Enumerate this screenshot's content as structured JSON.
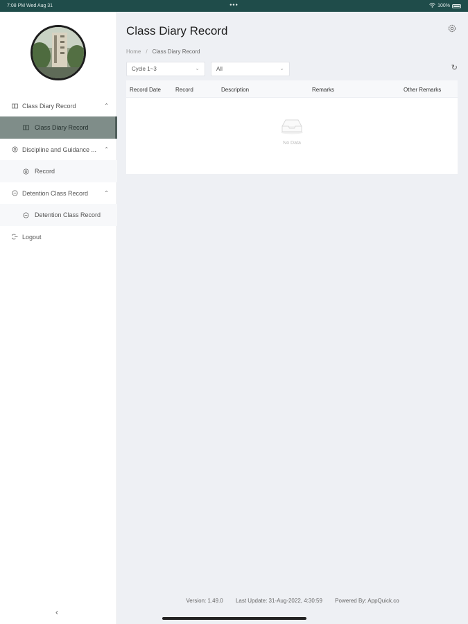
{
  "status_bar": {
    "time_date": "7:08 PM   Wed Aug 31",
    "center_dots": "•••",
    "battery_text": "100%"
  },
  "sidebar": {
    "menu": [
      {
        "label": "Class Diary Record",
        "icon": "book-icon",
        "children": [
          {
            "label": "Class Diary Record",
            "icon": "book-icon",
            "active": true
          }
        ]
      },
      {
        "label": "Discipline and Guidance ...",
        "icon": "settings-icon",
        "children": [
          {
            "label": "Record",
            "icon": "settings-icon",
            "active": false
          }
        ]
      },
      {
        "label": "Detention Class Record",
        "icon": "minus-circle-icon",
        "children": [
          {
            "label": "Detention Class Record",
            "icon": "minus-circle-icon",
            "active": false
          }
        ]
      }
    ],
    "logout_label": "Logout",
    "collapse_glyph": "‹"
  },
  "main": {
    "title": "Class Diary Record",
    "breadcrumb": {
      "home": "Home",
      "separator": "/",
      "current": "Class Diary Record"
    },
    "filters": {
      "cycle": "Cycle 1~3",
      "scope": "All"
    },
    "table": {
      "columns": [
        "Record Date",
        "Record",
        "Description",
        "Remarks",
        "Other Remarks"
      ],
      "empty_text": "No Data"
    }
  },
  "footer": {
    "version": "Version: 1.49.0",
    "last_update": "Last Update: 31-Aug-2022, 4:30:59",
    "powered_by": "Powered By: AppQuick.co"
  },
  "colors": {
    "status_bar": "#1f4c4a",
    "active_menu": "#7f8d89",
    "background": "#eef0f4"
  }
}
